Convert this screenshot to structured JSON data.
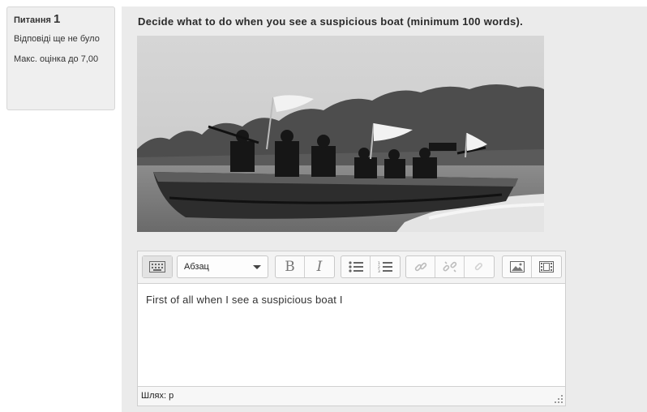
{
  "info": {
    "question_label": "Питання",
    "question_number": "1",
    "state": "Відповіді ще не було",
    "max_grade": "Макс. оцінка до 7,00"
  },
  "question": {
    "text": "Decide what to do when you see a suspicious boat (minimum 100 words).",
    "image_icon": "boat-photo"
  },
  "editor": {
    "format_select_value": "Абзац",
    "content": "First of all when I see a suspicious boat I",
    "path_label": "Шлях: p",
    "toolbar_icons": [
      "keyboard-toggle-icon",
      "bold-icon",
      "italic-icon",
      "bullet-list-icon",
      "numbered-list-icon",
      "link-icon",
      "unlink-icon",
      "anchor-icon",
      "image-icon",
      "media-icon"
    ]
  }
}
